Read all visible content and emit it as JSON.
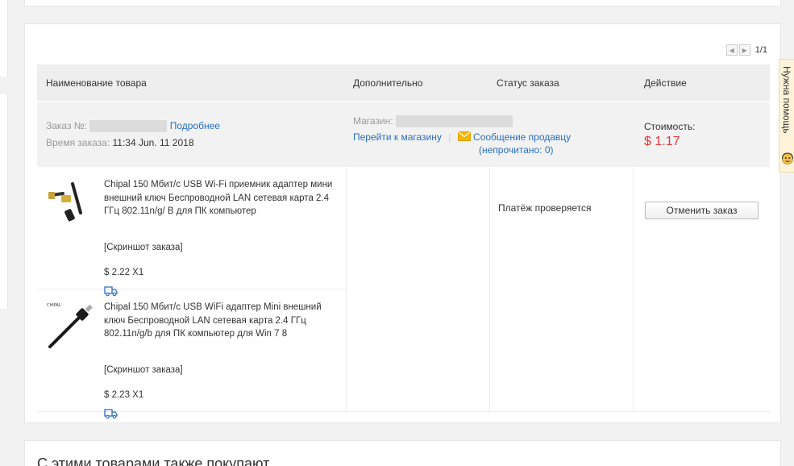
{
  "pager": {
    "prev_icon": "arrow-left-icon",
    "next_icon": "arrow-right-icon",
    "page_text": "1/1"
  },
  "table_header": {
    "product": "Наименование товара",
    "extra": "Дополнительно",
    "status": "Статус заказа",
    "action": "Действие"
  },
  "order": {
    "number_label": "Заказ №:",
    "details_link": "Подробнее",
    "time_label": "Время заказа:",
    "time_value": "11:34 Jun. 11 2018",
    "store_label": "Магазин:",
    "go_to_store": "Перейти к магазину",
    "separator": "|",
    "message_seller": "Сообщение продавцу",
    "unread": "(непрочитано: 0)",
    "cost_label": "Стоимость:",
    "cost_value": "$ 1.17",
    "status": "Платёж проверяется",
    "cancel_button": "Отменить заказ"
  },
  "items": [
    {
      "title": "Chipal 150 Мбит/с USB Wi-Fi приемник адаптер мини внешний ключ Беспроводной LAN сетевая карта 2.4 ГГц 802.11n/g/ B для ПК компьютер",
      "snapshot": "[Скриншот заказа]",
      "price": "$ 2.22 X1"
    },
    {
      "title": "Chipal 150 Мбит/с USB WiFi адаптер Mini внешний ключ Беспроводной LAN сетевая карта 2.4 ГГц 802.11n/g/b для ПК компьютер для Win 7 8",
      "snapshot": "[Скриншот заказа]",
      "price": "$ 2.23 X1"
    }
  ],
  "help_tab": {
    "label": "Нужна помощь"
  },
  "recommendations": {
    "title": "С этими товарами также покупают"
  },
  "colors": {
    "link": "#2a6ec2",
    "price": "#e4393c",
    "header_bg": "#eeeeee"
  }
}
